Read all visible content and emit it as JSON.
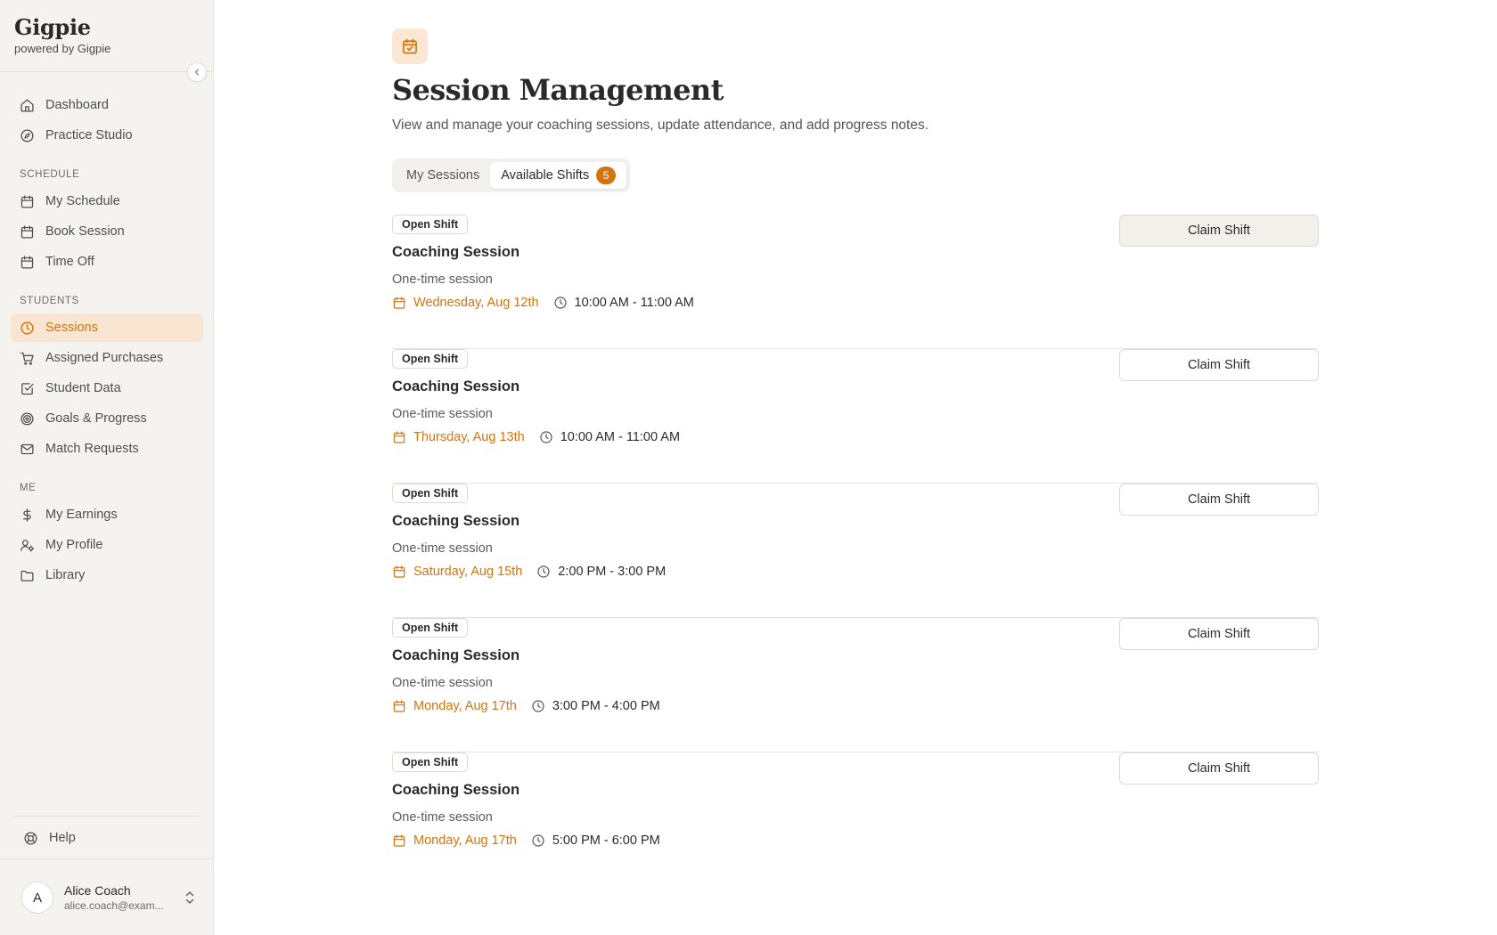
{
  "brand": {
    "title": "Gigpie",
    "subtitle": "powered by Gigpie"
  },
  "sidebar": {
    "top_items": [
      {
        "label": "Dashboard",
        "icon": "home-icon"
      },
      {
        "label": "Practice Studio",
        "icon": "compass-icon"
      }
    ],
    "sections": [
      {
        "title": "SCHEDULE",
        "items": [
          {
            "label": "My Schedule",
            "icon": "calendar-icon"
          },
          {
            "label": "Book Session",
            "icon": "calendar-icon"
          },
          {
            "label": "Time Off",
            "icon": "calendar-icon"
          }
        ]
      },
      {
        "title": "STUDENTS",
        "items": [
          {
            "label": "Sessions",
            "icon": "clock-icon",
            "active": true
          },
          {
            "label": "Assigned Purchases",
            "icon": "cart-icon"
          },
          {
            "label": "Student Data",
            "icon": "check-square-icon"
          },
          {
            "label": "Goals & Progress",
            "icon": "target-icon"
          },
          {
            "label": "Match Requests",
            "icon": "mail-icon"
          }
        ]
      },
      {
        "title": "ME",
        "items": [
          {
            "label": "My Earnings",
            "icon": "dollar-icon"
          },
          {
            "label": "My Profile",
            "icon": "user-cog-icon"
          },
          {
            "label": "Library",
            "icon": "folder-icon"
          }
        ]
      }
    ],
    "help_label": "Help",
    "user": {
      "initial": "A",
      "name": "Alice Coach",
      "email": "alice.coach@exam..."
    }
  },
  "colors": {
    "accent": "#d4740c",
    "accent_bg": "#f8e6d3",
    "sidebar_bg": "#f5f3ef"
  },
  "page": {
    "title": "Session Management",
    "description": "View and manage your coaching sessions, update attendance, and add progress notes.",
    "tabs": [
      {
        "label": "My Sessions",
        "active": false
      },
      {
        "label": "Available Shifts",
        "active": true,
        "badge": "5"
      }
    ]
  },
  "shifts": [
    {
      "badge": "Open Shift",
      "title": "Coaching Session",
      "type": "One-time session",
      "date": "Wednesday, Aug 12th",
      "time": "10:00 AM - 11:00 AM",
      "button": "Claim Shift"
    },
    {
      "badge": "Open Shift",
      "title": "Coaching Session",
      "type": "One-time session",
      "date": "Thursday, Aug 13th",
      "time": "10:00 AM - 11:00 AM",
      "button": "Claim Shift"
    },
    {
      "badge": "Open Shift",
      "title": "Coaching Session",
      "type": "One-time session",
      "date": "Saturday, Aug 15th",
      "time": "2:00 PM - 3:00 PM",
      "button": "Claim Shift"
    },
    {
      "badge": "Open Shift",
      "title": "Coaching Session",
      "type": "One-time session",
      "date": "Monday, Aug 17th",
      "time": "3:00 PM - 4:00 PM",
      "button": "Claim Shift"
    },
    {
      "badge": "Open Shift",
      "title": "Coaching Session",
      "type": "One-time session",
      "date": "Monday, Aug 17th",
      "time": "5:00 PM - 6:00 PM",
      "button": "Claim Shift"
    }
  ]
}
